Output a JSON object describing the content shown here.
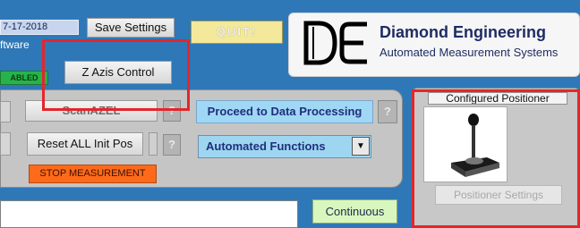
{
  "header": {
    "date_text": "7-17-2018",
    "software_label": "ftware",
    "enabled_badge": "ABLED",
    "save_settings": "Save Settings",
    "quit": "QUIT!",
    "zazis_control": "Z Azis Control"
  },
  "logo": {
    "title": "Diamond Engineering",
    "subtitle": "Automated Measurement Systems"
  },
  "main": {
    "scan_button": "ScanAZEL",
    "help": "?",
    "proceed": "Proceed to Data Processing",
    "reset_all": "Reset ALL Init Pos",
    "automated_functions": "Automated Functions",
    "stop_measurement": "STOP MEASUREMENT",
    "continuous": "Continuous"
  },
  "positioner": {
    "title": "Configured Positioner",
    "settings_button": "Positioner Settings"
  },
  "colors": {
    "background": "#2f78b8",
    "logo_text": "#1f2c63",
    "accent_blue": "#9fd7f5",
    "stop_orange": "#ff6a1a",
    "highlight_red": "#e3262b",
    "continuous_green": "#d7f7bf"
  }
}
